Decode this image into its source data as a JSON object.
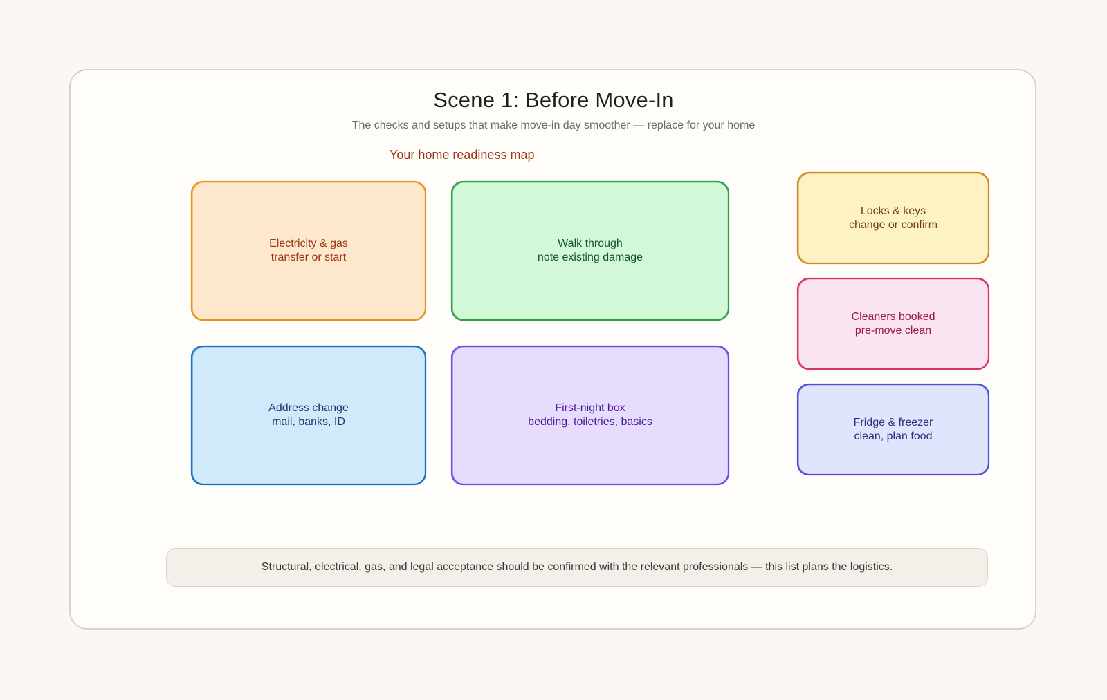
{
  "header": {
    "title": "Scene 1: Before Move-In",
    "subtitle": "The checks and setups that make move-in day smoother — replace for your home"
  },
  "map_label": "Your home readiness map",
  "boxes": [
    {
      "id": "electricity",
      "line1": "Electricity & gas",
      "line2": "transfer or start",
      "fill": "#fde8cd",
      "stroke": "#e8951f",
      "text_color": "#9a3412"
    },
    {
      "id": "walkthrough",
      "line1": "Walk through",
      "line2": "note existing damage",
      "fill": "#d3f8d8",
      "stroke": "#2f9e44",
      "text_color": "#14532d"
    },
    {
      "id": "address",
      "line1": "Address change",
      "line2": "mail, banks, ID",
      "fill": "#d0e9fb",
      "stroke": "#1971c2",
      "text_color": "#1e3a6e"
    },
    {
      "id": "firstnight",
      "line1": "First-night box",
      "line2": "bedding, toiletries, basics",
      "fill": "#e6dcfd",
      "stroke": "#7048e8",
      "text_color": "#4c1d95"
    },
    {
      "id": "locks",
      "line1": "Locks & keys",
      "line2": "change or confirm",
      "fill": "#fdf2c4",
      "stroke": "#d08a1c",
      "text_color": "#713f12"
    },
    {
      "id": "cleaners",
      "line1": "Cleaners booked",
      "line2": "pre-move clean",
      "fill": "#fbe4f2",
      "stroke": "#d6336c",
      "text_color": "#9d174d"
    },
    {
      "id": "fridge",
      "line1": "Fridge & freezer",
      "line2": "clean, plan food",
      "fill": "#e0e4fd",
      "stroke": "#4c4fd6",
      "text_color": "#312e81"
    }
  ],
  "footer_note": "Structural, electrical, gas, and legal acceptance should be confirmed with the relevant professionals — this list plans the logistics."
}
